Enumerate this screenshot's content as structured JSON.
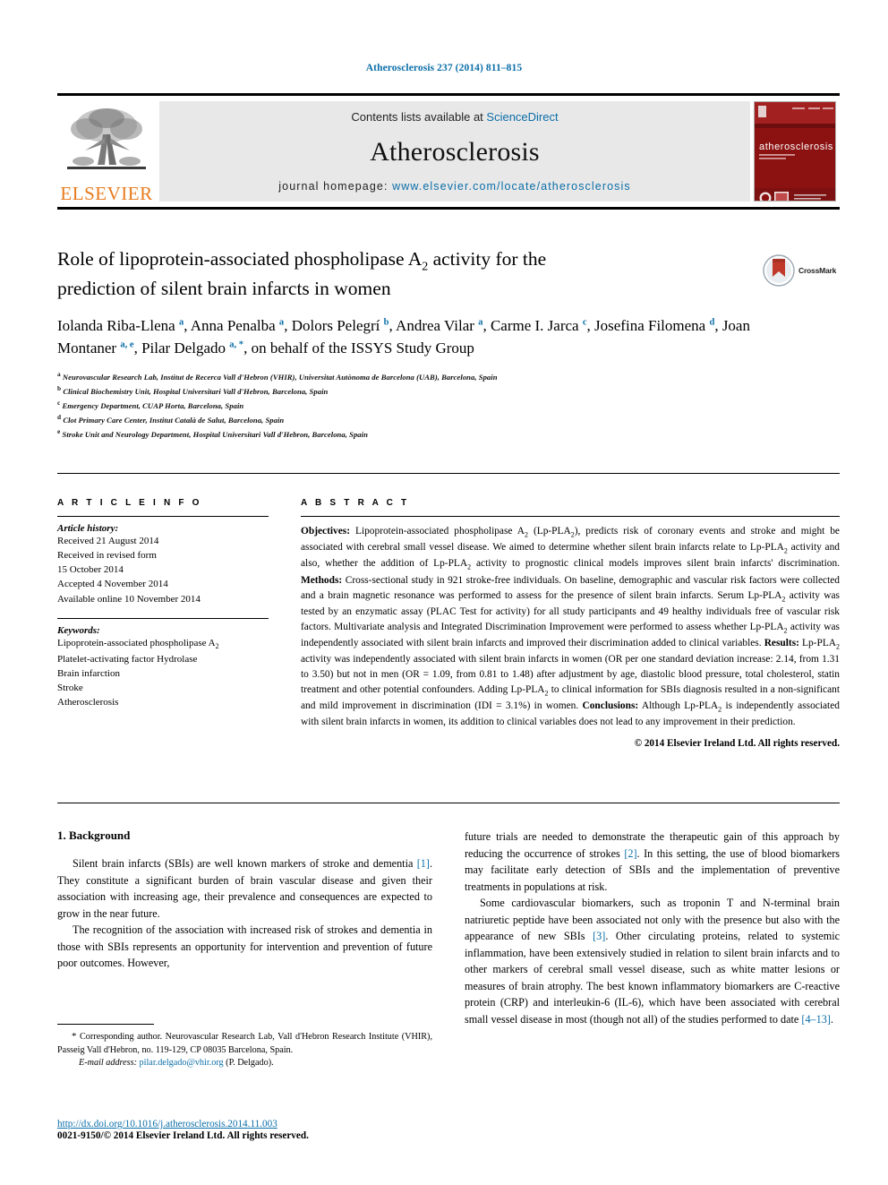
{
  "running_head": "Atherosclerosis 237 (2014) 811–815",
  "masthead": {
    "contents_prefix": "Contents lists available at ",
    "sciencedirect": "ScienceDirect",
    "journal_name": "Atherosclerosis",
    "homepage_prefix": "journal homepage: ",
    "homepage_url": "www.elsevier.com/locate/atherosclerosis",
    "publisher_logo_text": "ELSEVIER",
    "cover_title": "atherosclerosis",
    "accent_color": "#0b6ea8",
    "publisher_color": "#E87B1E",
    "cover_color": "#8c1212"
  },
  "article": {
    "title_line1": "Role of lipoprotein-associated phospholipase A",
    "title_sub1": "2",
    "title_line1_tail": " activity for the",
    "title_line2": "prediction of silent brain infarcts in women",
    "crossmark_label": "CrossMark",
    "authors_html": "Iolanda Riba-Llena <sup>a</sup>, Anna Penalba <sup>a</sup>, Dolors Pelegrí <sup>b</sup>, Andrea Vilar <sup>a</sup>, Carme I. Jarca <sup>c</sup>, Josefina Filomena <sup>d</sup>, Joan Montaner <sup>a, e</sup>, Pilar Delgado <sup>a, *</sup>, on behalf of the ISSYS Study Group",
    "affiliations": [
      {
        "mark": "a",
        "text": "Neurovascular Research Lab, Institut de Recerca Vall d'Hebron (VHIR), Universitat Autònoma de Barcelona (UAB), Barcelona, Spain"
      },
      {
        "mark": "b",
        "text": "Clinical Biochemistry Unit, Hospital Universitari Vall d'Hebron, Barcelona, Spain"
      },
      {
        "mark": "c",
        "text": "Emergency Department, CUAP Horta, Barcelona, Spain"
      },
      {
        "mark": "d",
        "text": "Clot Primary Care Center, Institut Català de Salut, Barcelona, Spain"
      },
      {
        "mark": "e",
        "text": "Stroke Unit and Neurology Department, Hospital Universitari Vall d'Hebron, Barcelona, Spain"
      }
    ]
  },
  "article_info": {
    "heading": "A R T I C L E  I N F O",
    "history_label": "Article history:",
    "history": [
      "Received 21 August 2014",
      "Received in revised form",
      "15 October 2014",
      "Accepted 4 November 2014",
      "Available online 10 November 2014"
    ],
    "keywords_label": "Keywords:",
    "keywords": [
      "Lipoprotein-associated phospholipase A2",
      "Platelet-activating factor Hydrolase",
      "Brain infarction",
      "Stroke",
      "Atherosclerosis"
    ]
  },
  "abstract": {
    "heading": "A B S T R A C T",
    "html": "<b>Objectives:</b> Lipoprotein-associated phospholipase A<sub>2</sub> (Lp-PLA<sub>2</sub>), predicts risk of coronary events and stroke and might be associated with cerebral small vessel disease. We aimed to determine whether silent brain infarcts relate to Lp-PLA<sub>2</sub> activity and also, whether the addition of Lp-PLA<sub>2</sub> activity to prognostic clinical models improves silent brain infarcts' discrimination. <b>Methods:</b> Cross-sectional study in 921 stroke-free individuals. On baseline, demographic and vascular risk factors were collected and a brain magnetic resonance was performed to assess for the presence of silent brain infarcts. Serum Lp-PLA<sub>2</sub> activity was tested by an enzymatic assay (PLAC Test for activity) for all study participants and 49 healthy individuals free of vascular risk factors. Multivariate analysis and Integrated Discrimination Improvement were performed to assess whether Lp-PLA<sub>2</sub> activity was independently associated with silent brain infarcts and improved their discrimination added to clinical variables. <b>Results:</b> Lp-PLA<sub>2</sub> activity was independently associated with silent brain infarcts in women (OR per one standard deviation increase: 2.14, from 1.31 to 3.50) but not in men (OR = 1.09, from 0.81 to 1.48) after adjustment by age, diastolic blood pressure, total cholesterol, statin treatment and other potential confounders. Adding Lp-PLA<sub>2</sub> to clinical information for SBIs diagnosis resulted in a non-significant and mild improvement in discrimination (IDI = 3.1%) in women. <b>Conclusions:</b> Although Lp-PLA<sub>2</sub> is independently associated with silent brain infarcts in women, its addition to clinical variables does not lead to any improvement in their prediction.",
    "copyright": "© 2014 Elsevier Ireland Ltd. All rights reserved."
  },
  "body": {
    "section_heading": "1. Background",
    "left_paragraphs": [
      "Silent brain infarcts (SBIs) are well known markers of stroke and dementia <span class=\"ref\">[1]</span>. They constitute a significant burden of brain vascular disease and given their association with increasing age, their prevalence and consequences are expected to grow in the near future.",
      "The recognition of the association with increased risk of strokes and dementia in those with SBIs represents an opportunity for intervention and prevention of future poor outcomes. However,"
    ],
    "right_paragraphs": [
      "future trials are needed to demonstrate the therapeutic gain of this approach by reducing the occurrence of strokes <span class=\"ref\">[2]</span>. In this setting, the use of blood biomarkers may facilitate early detection of SBIs and the implementation of preventive treatments in populations at risk.",
      "Some cardiovascular biomarkers, such as troponin T and N-terminal brain natriuretic peptide have been associated not only with the presence but also with the appearance of new SBIs <span class=\"ref\">[3]</span>. Other circulating proteins, related to systemic inflammation, have been extensively studied in relation to silent brain infarcts and to other markers of cerebral small vessel disease, such as white matter lesions or measures of brain atrophy. The best known inflammatory biomarkers are C-reactive protein (CRP) and interleukin-6 (IL-6), which have been associated with cerebral small vessel disease in most (though not all) of the studies performed to date <span class=\"ref\">[4–13]</span>."
    ]
  },
  "footnote": {
    "corresponding_html": "<span class=\"star\">*</span> Corresponding author. Neurovascular Research Lab, Vall d'Hebron Research Institute (VHIR), Passeig Vall d'Hebron, no. 119-129, CP 08035 Barcelona, Spain.",
    "email_label": "E-mail address:",
    "email": "pilar.delgado@vhir.org",
    "email_suffix": "(P. Delgado)."
  },
  "footer": {
    "doi": "http://dx.doi.org/10.1016/j.atherosclerosis.2014.11.003",
    "issn_line": "0021-9150/© 2014 Elsevier Ireland Ltd. All rights reserved."
  }
}
